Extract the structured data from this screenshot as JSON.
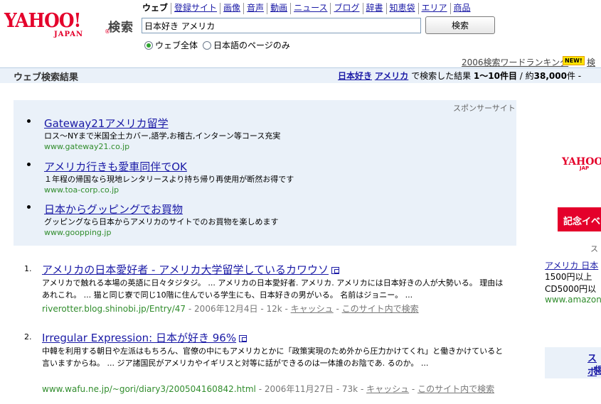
{
  "logo": {
    "yahoo": "YAHOO!",
    "japan": "JAPAN",
    "reg": "®"
  },
  "header": {
    "title": "検索"
  },
  "nav": [
    "ウェブ",
    "登録サイト",
    "画像",
    "音声",
    "動画",
    "ニュース",
    "ブログ",
    "辞書",
    "知恵袋",
    "エリア",
    "商品"
  ],
  "search": {
    "value": "日本好き アメリカ",
    "button": "検索"
  },
  "radios": [
    {
      "label": "ウェブ全体",
      "checked": true
    },
    {
      "label": "日本語のページのみ",
      "checked": false
    }
  ],
  "ranking": {
    "label": "2006検索ワードランキング",
    "badge": "NEW!",
    "cut": "検"
  },
  "result_bar": {
    "title": "ウェブ検索結果",
    "kw1": "日本好き",
    "kw2": "アメリカ",
    "mid": "で検索した結果",
    "range": "1〜10件目",
    "sep": " / ",
    "total_prefix": "約",
    "total": "38,000",
    "total_suffix": "件 -"
  },
  "sponsor": {
    "label": "スポンサーサイト",
    "ads": [
      {
        "title": "Gateway21アメリカ留学",
        "desc": "ロス〜NYまで米国全土カバー,語学,お稽古,インターン等コース充実",
        "url": "www.gateway21.co.jp"
      },
      {
        "title": "アメリカ行きも愛車同伴でOK",
        "desc": "１年程の帰国なら現地レンタリースより持ち帰り再使用が断然お得です",
        "url": "www.toa-corp.co.jp"
      },
      {
        "title": "日本からグッピングでお買物",
        "desc": "グッピングなら日本からアメリカのサイトでのお買物を楽しめます",
        "url": "www.goopping.jp"
      }
    ]
  },
  "results": [
    {
      "num": "1.",
      "title": "アメリカの日本愛好者 - アメリカ大学留学しているカワウソ",
      "desc": "アメリカで触れる本場の英語に日々タジタジ。 ... アメリカの日本愛好者. アメリカ. アメリカには日本好きの人が大勢いる。 理由はあれこれ。 ... 猫と同じ寮で同じ10階に住んでいる学生にも、日本好きの男がいる。 名前はジョニー。 ...",
      "url": "riverotter.blog.shinobi.jp/Entry/47",
      "date": "2006年12月4日",
      "size": "12k",
      "cache": "キャッシュ",
      "site": "このサイト内で検索"
    },
    {
      "num": "2.",
      "title": "Irregular Expression: 日本が好き 96%",
      "desc": "中韓を利用する朝日や左派はもちろん、官僚の中にもアメリカとかに「政策実現のため外から圧力かけてくれ」と働きかけていると言いますからね。 ... ジア諸国民がアメリカやイギリスと対等に話ができるのは一体誰のお陰であ. るのか。 ...",
      "url": "www.wafu.ne.jp/~gori/diary3/200504160842.html",
      "date": "2006年11月27日",
      "size": "73k",
      "cache": "キャッシュ",
      "site": "このサイト内で検索"
    }
  ],
  "meta_sep": " - ",
  "right": {
    "yahoo": "YAHOO",
    "japan": "JAP",
    "event": "記念イベ",
    "sponsor": "ス",
    "ad_title": "アメリカ 日本",
    "ad_l1": "1500円以上",
    "ad_l2": "CD5000円以",
    "ad_url": "www.amazon",
    "box_l1": "スポ",
    "box_l2": "掲"
  }
}
